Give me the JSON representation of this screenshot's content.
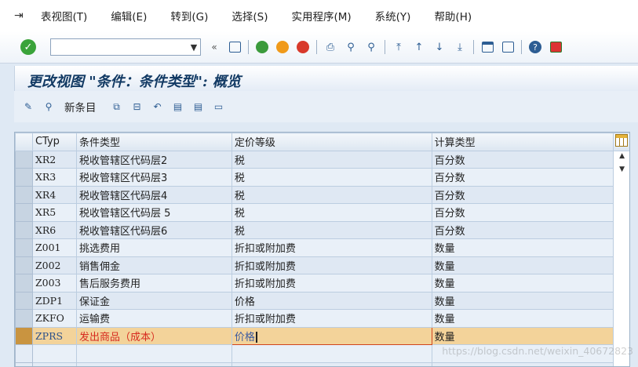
{
  "menubar": {
    "items": [
      "表视图(T)",
      "编辑(E)",
      "转到(G)",
      "选择(S)",
      "实用程序(M)",
      "系统(Y)",
      "帮助(H)"
    ]
  },
  "toolbar": {
    "command_value": "",
    "icons": [
      "enter-icon",
      "save-icon",
      "back-icon",
      "exit-icon",
      "cancel-icon",
      "print-icon",
      "find-icon",
      "find-next-icon",
      "first-page-icon",
      "previous-page-icon",
      "next-page-icon",
      "last-page-icon",
      "create-session-icon",
      "shortcut-icon",
      "help-icon",
      "layout-icon"
    ]
  },
  "screen": {
    "title": "更改视图 \"条件：条件类型\": 概览"
  },
  "app_toolbar": {
    "new_entries_label": "新条目"
  },
  "table": {
    "headers": [
      "CTyp",
      "条件类型",
      "定价等级",
      "计算类型"
    ],
    "rows": [
      [
        "XR2",
        "税收管辖区代码层2",
        "税",
        "百分数"
      ],
      [
        "XR3",
        "税收管辖区代码层3",
        "税",
        "百分数"
      ],
      [
        "XR4",
        "税收管辖区代码层4",
        "税",
        "百分数"
      ],
      [
        "XR5",
        "税收管辖区代码层 5",
        "税",
        "百分数"
      ],
      [
        "XR6",
        "税收管辖区代码层6",
        "税",
        "百分数"
      ],
      [
        "Z001",
        "挑选费用",
        "折扣或附加费",
        "数量"
      ],
      [
        "Z002",
        "销售佣金",
        "折扣或附加费",
        "数量"
      ],
      [
        "Z003",
        "售后服务费用",
        "折扣或附加费",
        "数量"
      ],
      [
        "ZDP1",
        "保证金",
        "价格",
        "数量"
      ],
      [
        "ZKFO",
        "运输费",
        "折扣或附加费",
        "数量"
      ],
      [
        "ZPRS",
        "发出商品（成本）",
        "价格",
        "数量"
      ]
    ],
    "current_row_index": 10
  },
  "watermark": "https://blog.csdn.net/weixin_40672823",
  "colors": {
    "accent": "#123a64",
    "current_row": "#f3d39a",
    "current_text": "#d72b1f"
  }
}
